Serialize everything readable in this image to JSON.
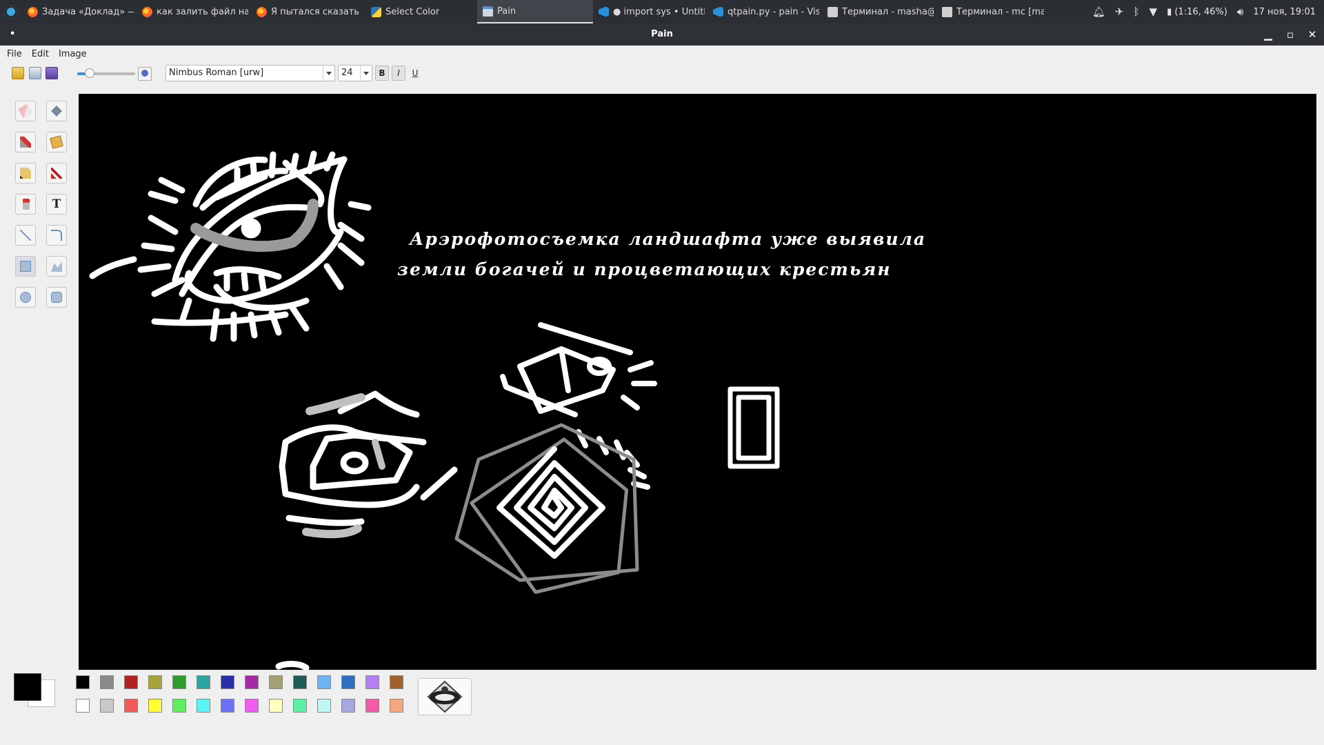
{
  "taskbar": {
    "tasks": [
      {
        "label": "Задача «Доклад» — ...",
        "icon": "firefox-icon"
      },
      {
        "label": "как залить файл на ...",
        "icon": "firefox-icon"
      },
      {
        "label": "Я пытался сказать н...",
        "icon": "firefox-icon"
      },
      {
        "label": "Select Color",
        "icon": "python-icon"
      },
      {
        "label": "Pain",
        "icon": "window-icon",
        "active": true
      },
      {
        "label": "● import sys • Untitl...",
        "icon": "vscode-icon"
      },
      {
        "label": "qtpain.py - pain - Visu...",
        "icon": "vscode-icon"
      },
      {
        "label": "Терминал - masha@...",
        "icon": "terminal-icon"
      },
      {
        "label": "Терминал - mc [mas...",
        "icon": "terminal-icon"
      }
    ],
    "tray": {
      "battery": "(1:16, 46%)",
      "datetime": "17 ноя, 19:01"
    }
  },
  "window": {
    "title": "Pain",
    "menu_dot": "•"
  },
  "menu": {
    "file": "File",
    "edit": "Edit",
    "image": "Image"
  },
  "toolbar": {
    "font": "Nimbus Roman [urw]",
    "font_size": "24",
    "bold": "B",
    "italic": "I",
    "underline": "U",
    "brush_size_fraction": 0.22
  },
  "canvas": {
    "background": "#000000",
    "text_line1": "Арэрофотосъемка ландшафта уже выявила",
    "text_line2": "земли богачей и процветающих крестьян"
  },
  "colors": {
    "foreground": "#000000",
    "background": "#ffffff",
    "palette_row1": [
      "#000000",
      "#8a8a8a",
      "#b22222",
      "#a6a33a",
      "#2e9c2e",
      "#2aa5a0",
      "#2a2fa8",
      "#a52aa6",
      "#a3a073",
      "#1f5c55",
      "#6fb3f5",
      "#2e6fc4",
      "#b47ff0",
      "#a0622a"
    ],
    "palette_row2": [
      "#ffffff",
      "#c8c8c8",
      "#f25a5a",
      "#ffff33",
      "#5cf05c",
      "#5af5f5",
      "#6f6ff5",
      "#f05cf0",
      "#ffffc0",
      "#5cf0a6",
      "#bff5f5",
      "#a6a6e0",
      "#f05ca6",
      "#f5a67f"
    ]
  }
}
